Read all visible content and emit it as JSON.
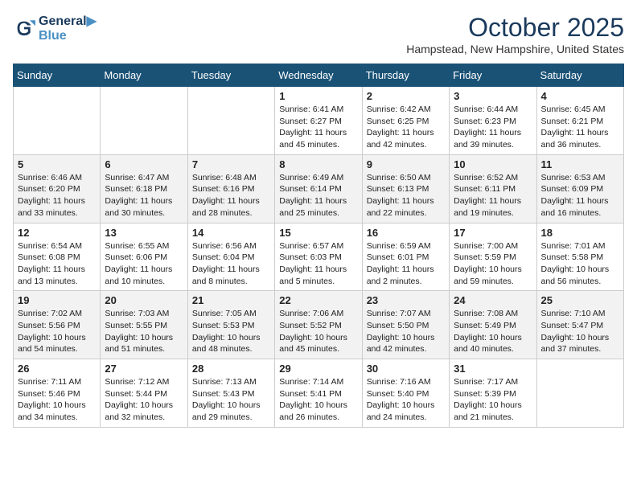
{
  "header": {
    "logo_line1": "General",
    "logo_line2": "Blue",
    "month": "October 2025",
    "location": "Hampstead, New Hampshire, United States"
  },
  "days_of_week": [
    "Sunday",
    "Monday",
    "Tuesday",
    "Wednesday",
    "Thursday",
    "Friday",
    "Saturday"
  ],
  "weeks": [
    [
      {
        "day": "",
        "info": ""
      },
      {
        "day": "",
        "info": ""
      },
      {
        "day": "",
        "info": ""
      },
      {
        "day": "1",
        "info": "Sunrise: 6:41 AM\nSunset: 6:27 PM\nDaylight: 11 hours\nand 45 minutes."
      },
      {
        "day": "2",
        "info": "Sunrise: 6:42 AM\nSunset: 6:25 PM\nDaylight: 11 hours\nand 42 minutes."
      },
      {
        "day": "3",
        "info": "Sunrise: 6:44 AM\nSunset: 6:23 PM\nDaylight: 11 hours\nand 39 minutes."
      },
      {
        "day": "4",
        "info": "Sunrise: 6:45 AM\nSunset: 6:21 PM\nDaylight: 11 hours\nand 36 minutes."
      }
    ],
    [
      {
        "day": "5",
        "info": "Sunrise: 6:46 AM\nSunset: 6:20 PM\nDaylight: 11 hours\nand 33 minutes."
      },
      {
        "day": "6",
        "info": "Sunrise: 6:47 AM\nSunset: 6:18 PM\nDaylight: 11 hours\nand 30 minutes."
      },
      {
        "day": "7",
        "info": "Sunrise: 6:48 AM\nSunset: 6:16 PM\nDaylight: 11 hours\nand 28 minutes."
      },
      {
        "day": "8",
        "info": "Sunrise: 6:49 AM\nSunset: 6:14 PM\nDaylight: 11 hours\nand 25 minutes."
      },
      {
        "day": "9",
        "info": "Sunrise: 6:50 AM\nSunset: 6:13 PM\nDaylight: 11 hours\nand 22 minutes."
      },
      {
        "day": "10",
        "info": "Sunrise: 6:52 AM\nSunset: 6:11 PM\nDaylight: 11 hours\nand 19 minutes."
      },
      {
        "day": "11",
        "info": "Sunrise: 6:53 AM\nSunset: 6:09 PM\nDaylight: 11 hours\nand 16 minutes."
      }
    ],
    [
      {
        "day": "12",
        "info": "Sunrise: 6:54 AM\nSunset: 6:08 PM\nDaylight: 11 hours\nand 13 minutes."
      },
      {
        "day": "13",
        "info": "Sunrise: 6:55 AM\nSunset: 6:06 PM\nDaylight: 11 hours\nand 10 minutes."
      },
      {
        "day": "14",
        "info": "Sunrise: 6:56 AM\nSunset: 6:04 PM\nDaylight: 11 hours\nand 8 minutes."
      },
      {
        "day": "15",
        "info": "Sunrise: 6:57 AM\nSunset: 6:03 PM\nDaylight: 11 hours\nand 5 minutes."
      },
      {
        "day": "16",
        "info": "Sunrise: 6:59 AM\nSunset: 6:01 PM\nDaylight: 11 hours\nand 2 minutes."
      },
      {
        "day": "17",
        "info": "Sunrise: 7:00 AM\nSunset: 5:59 PM\nDaylight: 10 hours\nand 59 minutes."
      },
      {
        "day": "18",
        "info": "Sunrise: 7:01 AM\nSunset: 5:58 PM\nDaylight: 10 hours\nand 56 minutes."
      }
    ],
    [
      {
        "day": "19",
        "info": "Sunrise: 7:02 AM\nSunset: 5:56 PM\nDaylight: 10 hours\nand 54 minutes."
      },
      {
        "day": "20",
        "info": "Sunrise: 7:03 AM\nSunset: 5:55 PM\nDaylight: 10 hours\nand 51 minutes."
      },
      {
        "day": "21",
        "info": "Sunrise: 7:05 AM\nSunset: 5:53 PM\nDaylight: 10 hours\nand 48 minutes."
      },
      {
        "day": "22",
        "info": "Sunrise: 7:06 AM\nSunset: 5:52 PM\nDaylight: 10 hours\nand 45 minutes."
      },
      {
        "day": "23",
        "info": "Sunrise: 7:07 AM\nSunset: 5:50 PM\nDaylight: 10 hours\nand 42 minutes."
      },
      {
        "day": "24",
        "info": "Sunrise: 7:08 AM\nSunset: 5:49 PM\nDaylight: 10 hours\nand 40 minutes."
      },
      {
        "day": "25",
        "info": "Sunrise: 7:10 AM\nSunset: 5:47 PM\nDaylight: 10 hours\nand 37 minutes."
      }
    ],
    [
      {
        "day": "26",
        "info": "Sunrise: 7:11 AM\nSunset: 5:46 PM\nDaylight: 10 hours\nand 34 minutes."
      },
      {
        "day": "27",
        "info": "Sunrise: 7:12 AM\nSunset: 5:44 PM\nDaylight: 10 hours\nand 32 minutes."
      },
      {
        "day": "28",
        "info": "Sunrise: 7:13 AM\nSunset: 5:43 PM\nDaylight: 10 hours\nand 29 minutes."
      },
      {
        "day": "29",
        "info": "Sunrise: 7:14 AM\nSunset: 5:41 PM\nDaylight: 10 hours\nand 26 minutes."
      },
      {
        "day": "30",
        "info": "Sunrise: 7:16 AM\nSunset: 5:40 PM\nDaylight: 10 hours\nand 24 minutes."
      },
      {
        "day": "31",
        "info": "Sunrise: 7:17 AM\nSunset: 5:39 PM\nDaylight: 10 hours\nand 21 minutes."
      },
      {
        "day": "",
        "info": ""
      }
    ]
  ]
}
